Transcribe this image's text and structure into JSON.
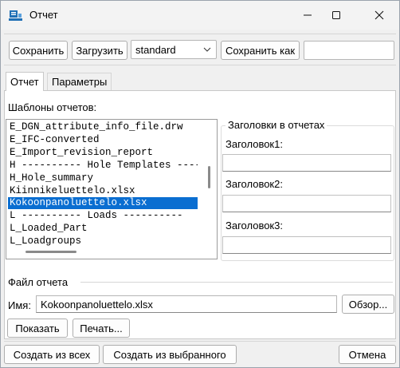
{
  "window": {
    "title": "Отчет"
  },
  "toolbar": {
    "save_label": "Сохранить",
    "load_label": "Загрузить",
    "template_value": "standard",
    "save_as_label": "Сохранить как",
    "save_as_value": ""
  },
  "tabs": [
    {
      "label": "Отчет",
      "active": true
    },
    {
      "label": "Параметры",
      "active": false
    }
  ],
  "templates": {
    "label": "Шаблоны отчетов:",
    "items": [
      "E_DGN_attribute_info_file.drw",
      "E_IFC-converted",
      "E_Import_revision_report",
      "H ---------- Hole Templates ----------",
      "H_Hole_summary",
      "Kiinnikeluettelo.xlsx",
      "Kokoonpanoluettelo.xlsx",
      "L ---------- Loads ----------",
      "L_Loaded_Part",
      "L_Loadgroups"
    ],
    "selected_index": 6
  },
  "headers": {
    "legend": "Заголовки в отчетах",
    "header1_label": "Заголовок1:",
    "header1_value": "",
    "header2_label": "Заголовок2:",
    "header2_value": "",
    "header3_label": "Заголовок3:",
    "header3_value": ""
  },
  "report_file": {
    "legend": "Файл отчета",
    "name_label": "Имя:",
    "name_value": "Kokoonpanoluettelo.xlsx",
    "browse_label": "Обзор...",
    "show_label": "Показать",
    "print_label": "Печать..."
  },
  "footer": {
    "create_all_label": "Создать из всех",
    "create_selected_label": "Создать из выбранного",
    "cancel_label": "Отмена"
  },
  "colors": {
    "selection": "#0a6ed1",
    "window_bg": "#f0f0f0"
  },
  "icons": [
    "app-icon",
    "minimize-icon",
    "maximize-icon",
    "close-icon",
    "chevron-down-icon"
  ]
}
